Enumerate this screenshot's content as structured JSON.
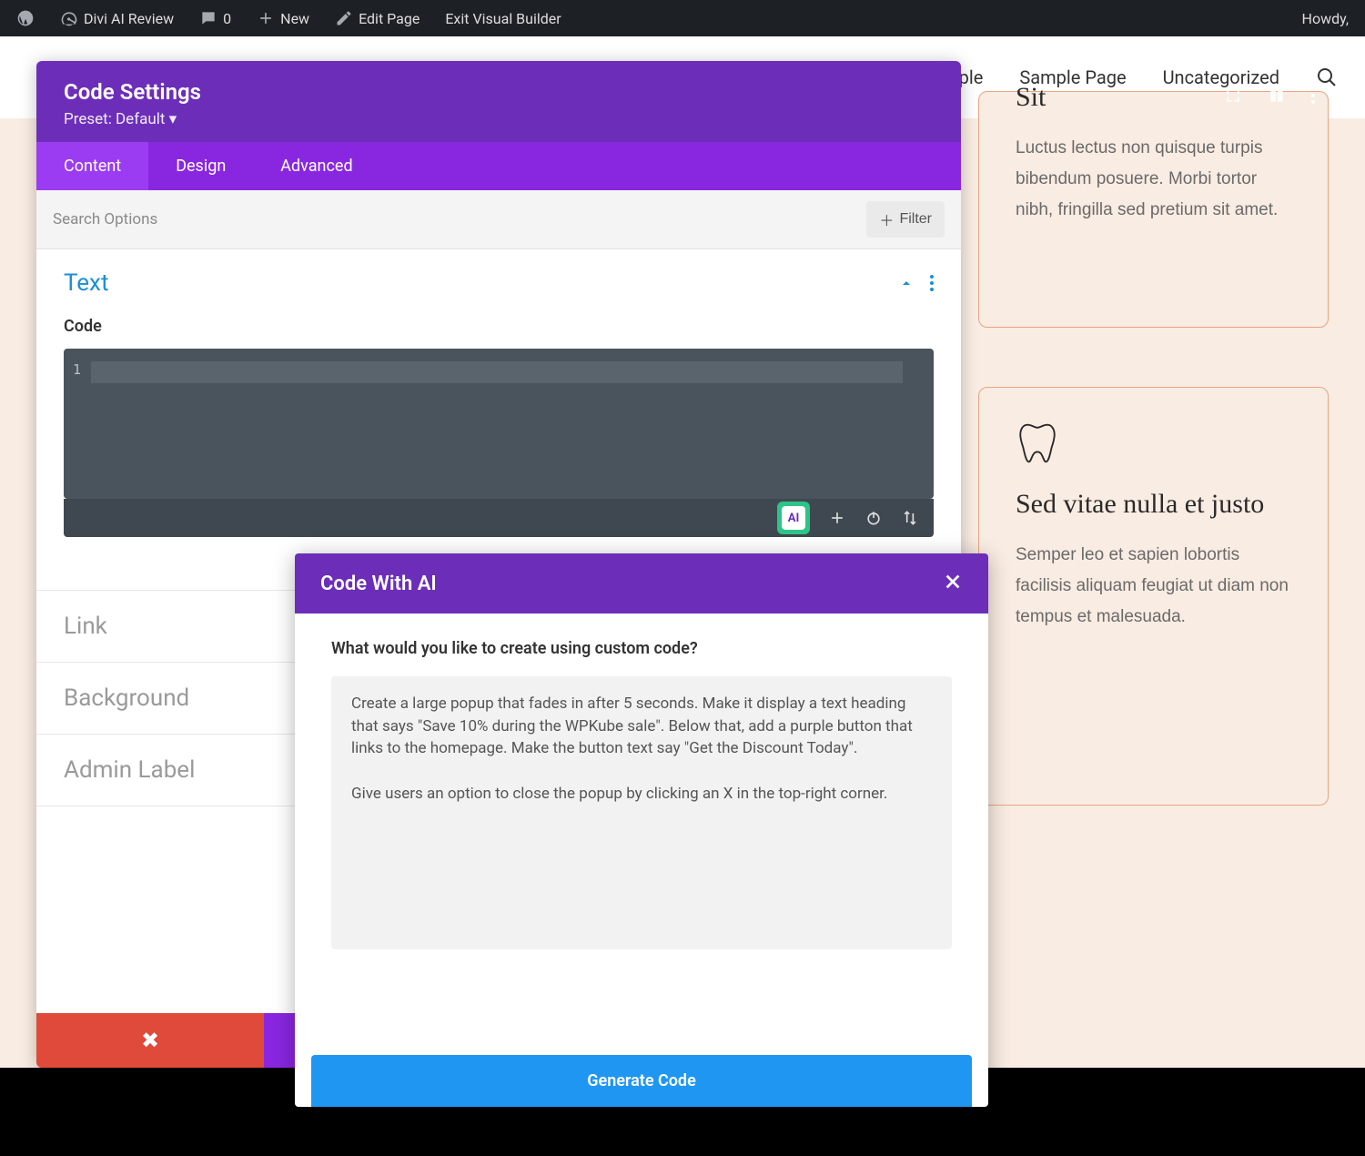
{
  "wp_admin": {
    "site_title": "Divi AI Review",
    "comments": "0",
    "new_label": "New",
    "edit_label": "Edit Page",
    "exit_label": "Exit Visual Builder",
    "howdy": "Howdy,"
  },
  "top_nav": {
    "item_ple": "ple",
    "item_sample": "Sample Page",
    "item_uncat": "Uncategorized"
  },
  "sidebar_cards": {
    "card1_title_fragment": "Sit",
    "card1_body": "Luctus lectus non quisque turpis bibendum posuere. Morbi tortor nibh, fringilla sed pretium sit amet.",
    "card2_icon": "tooth-icon",
    "card2_title": "Sed vitae nulla et justo",
    "card2_body": "Semper leo et sapien lobortis facilisis aliquam feugiat ut diam non tempus et malesuada."
  },
  "modal": {
    "title": "Code Settings",
    "preset": "Preset: Default",
    "tabs": {
      "content": "Content",
      "design": "Design",
      "advanced": "Advanced"
    },
    "search_placeholder": "Search Options",
    "filter_label": "Filter",
    "section_title": "Text",
    "code_label": "Code",
    "line_number": "1",
    "ai_button": "AI",
    "accordion": {
      "link": "Link",
      "background": "Background",
      "admin_label": "Admin Label"
    },
    "cancel_icon": "✖"
  },
  "ai_modal": {
    "title": "Code With AI",
    "question": "What would you like to create using custom code?",
    "textarea_value": "Create a large popup that fades in after 5 seconds. Make it display a text heading that says \"Save 10% during the WPKube sale\". Below that, add a purple button that links to the homepage. Make the button text say \"Get the Discount Today\".\n\nGive users an option to close the popup by clicking an X in the top-right corner.",
    "generate_label": "Generate Code"
  }
}
